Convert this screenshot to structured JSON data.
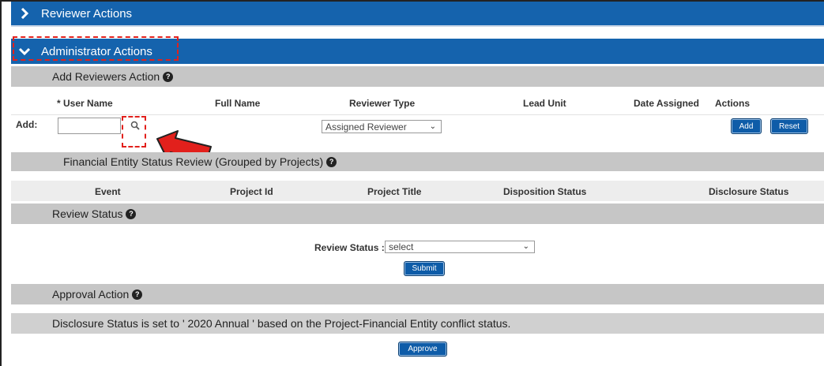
{
  "reviewer_actions": {
    "title": "Reviewer Actions"
  },
  "admin_actions": {
    "title": "Administrator Actions"
  },
  "add_reviewers": {
    "title": "Add Reviewers Action",
    "columns": {
      "user_name": "* User Name",
      "full_name": "Full Name",
      "reviewer_type": "Reviewer Type",
      "lead_unit": "Lead Unit",
      "date_assigned": "Date Assigned",
      "actions": "Actions"
    },
    "add_label": "Add:",
    "user_name_value": "",
    "reviewer_type_selected": "Assigned Reviewer",
    "add_button": "Add",
    "reset_button": "Reset"
  },
  "financial_entity": {
    "title": "Financial Entity Status Review (Grouped by Projects)",
    "columns": {
      "event": "Event",
      "project_id": "Project Id",
      "project_title": "Project Title",
      "disposition_status": "Disposition Status",
      "disclosure_status": "Disclosure Status"
    }
  },
  "review_status": {
    "title": "Review Status",
    "label": "Review Status :",
    "selected": "select",
    "submit_button": "Submit"
  },
  "approval_action": {
    "title": "Approval Action",
    "message": "Disclosure Status is set to ' 2020 Annual ' based on the Project-Financial Entity conflict status.",
    "approve_button": "Approve"
  },
  "colors": {
    "header_blue": "#1563ad",
    "section_gray": "#c6c6c6",
    "button_blue": "#0e5ca8",
    "annotation_red": "#e2201c"
  },
  "icons": {
    "expand": "chevron-right-icon",
    "collapse": "chevron-down-icon",
    "lookup": "search-icon",
    "help": "help-icon",
    "annotation": "red-arrow-icon"
  }
}
